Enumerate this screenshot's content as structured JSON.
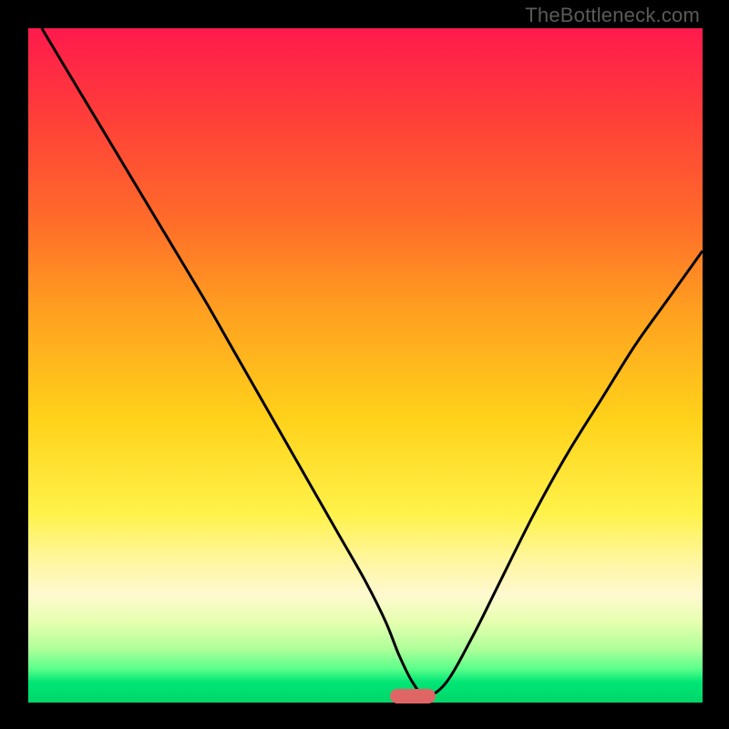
{
  "attribution": "TheBottleneck.com",
  "colors": {
    "frame": "#000000",
    "curve": "#000000",
    "marker": "#e06666"
  },
  "chart_data": {
    "type": "line",
    "title": "",
    "xlabel": "",
    "ylabel": "",
    "xlim": [
      0,
      100
    ],
    "ylim": [
      0,
      100
    ],
    "grid": false,
    "legend": false,
    "series": [
      {
        "name": "bottleneck-curve",
        "x": [
          2,
          8,
          14,
          20,
          26,
          30,
          34,
          38,
          42,
          46,
          50,
          53,
          55,
          57,
          59,
          62,
          66,
          70,
          75,
          80,
          85,
          90,
          95,
          100
        ],
        "y": [
          100,
          90,
          80,
          70,
          60,
          53,
          46,
          39,
          32,
          25,
          18,
          12,
          7,
          3,
          1,
          3,
          10,
          18,
          28,
          37,
          45,
          53,
          60,
          67
        ]
      }
    ],
    "annotations": [
      {
        "name": "optimal-marker",
        "x": 57,
        "y": 1,
        "shape": "rounded-rect",
        "color": "#e06666"
      }
    ],
    "background_gradient": [
      {
        "stop": 0.0,
        "color": "#ff1a4d"
      },
      {
        "stop": 0.28,
        "color": "#ff6a2a"
      },
      {
        "stop": 0.58,
        "color": "#ffd21a"
      },
      {
        "stop": 0.84,
        "color": "#fff9d0"
      },
      {
        "stop": 0.95,
        "color": "#5aff8a"
      },
      {
        "stop": 1.0,
        "color": "#00d66a"
      }
    ]
  }
}
